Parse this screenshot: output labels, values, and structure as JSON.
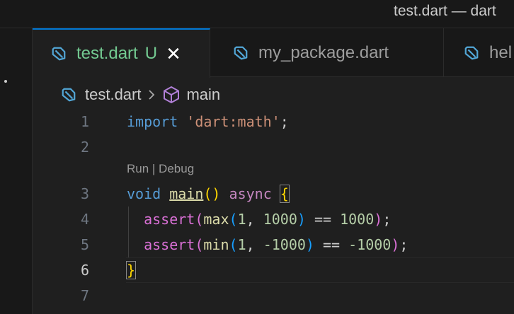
{
  "window": {
    "title": "test.dart — dart"
  },
  "tabs": [
    {
      "label": "test.dart",
      "status": "U",
      "close": "✕",
      "active": true
    },
    {
      "label": "my_package.dart",
      "active": false
    },
    {
      "label": "hel",
      "active": false
    }
  ],
  "breadcrumb": {
    "file": "test.dart",
    "separator": "›",
    "symbol": "main"
  },
  "codelens": {
    "text": "Run | Debug"
  },
  "gutter": [
    "1",
    "2",
    "3",
    "4",
    "5",
    "6",
    "7"
  ],
  "code": {
    "line1": {
      "kw": "import",
      "str": "'dart:math'",
      "end": ";"
    },
    "line3": {
      "kw": "void",
      "fn": "main",
      "parens": "()",
      "async": "async",
      "brace": "{"
    },
    "line4": {
      "fn": "assert",
      "open": "(",
      "fn2": "max",
      "open2": "(",
      "a": "1",
      "comma": ", ",
      "b": "1000",
      "close2": ")",
      "op": " == ",
      "c": "1000",
      "close": ")",
      "end": ";"
    },
    "line5": {
      "fn": "assert",
      "open": "(",
      "fn2": "min",
      "open2": "(",
      "a": "1",
      "comma": ", ",
      "b": "-1000",
      "close2": ")",
      "op": " == ",
      "c": "-1000",
      "close": ")",
      "end": ";"
    },
    "line6": {
      "brace": "}"
    }
  },
  "colors": {
    "accent": "#0078d4",
    "untracked": "#73c991",
    "dart": "#52a6d6"
  }
}
